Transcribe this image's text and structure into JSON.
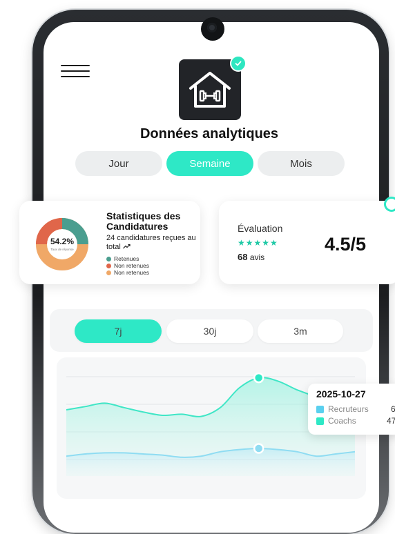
{
  "header": {
    "title": "Données analytiques"
  },
  "period_tabs": [
    {
      "label": "Jour",
      "active": false
    },
    {
      "label": "Semaine",
      "active": true
    },
    {
      "label": "Mois",
      "active": false
    }
  ],
  "stats_card": {
    "title": "Statistiques des Candidatures",
    "subtitle": "24 candidatures reçues au total",
    "trend_icon": "trend-up-icon",
    "donut_percent": "54.2%",
    "donut_caption": "Taux de réponse",
    "legend": [
      {
        "label": "Retenues",
        "color": "#4a9e8f"
      },
      {
        "label": "Non retenues",
        "color": "#e0664a"
      },
      {
        "label": "Non retenues",
        "color": "#f0a867"
      }
    ]
  },
  "evaluation_card": {
    "label": "Évaluation",
    "stars": "★★★★★",
    "rating_value": 4.5,
    "reviews_count": "68",
    "reviews_label": "avis",
    "score": "4.5/5"
  },
  "range_tabs": [
    {
      "label": "7j",
      "active": true
    },
    {
      "label": "30j",
      "active": false
    },
    {
      "label": "3m",
      "active": false
    }
  ],
  "tooltip": {
    "date": "2025-10-27",
    "rows": [
      {
        "label": "Recruteurs",
        "value": "6",
        "color": "#5ad0ef"
      },
      {
        "label": "Coachs",
        "value": "47",
        "color": "#2ee8c6"
      }
    ]
  },
  "colors": {
    "accent": "#2ee8c6",
    "dark": "#222428",
    "retenues": "#4a9e8f",
    "non_retenues_red": "#e0664a",
    "non_retenues_orange": "#f0a867",
    "recruteurs": "#5ad0ef"
  },
  "chart_data": {
    "type": "area",
    "series": [
      {
        "name": "Coachs",
        "values": [
          60,
          63,
          66,
          62,
          58,
          55,
          56,
          54,
          62,
          80,
          89,
          86,
          78,
          72,
          68,
          66
        ]
      },
      {
        "name": "Recruteurs",
        "values": [
          18,
          20,
          21,
          21,
          20,
          19,
          17,
          18,
          22,
          24,
          25,
          24,
          22,
          18,
          20,
          22
        ]
      }
    ],
    "highlight_index": 10,
    "ylim": [
      0,
      100
    ],
    "grid": true
  }
}
